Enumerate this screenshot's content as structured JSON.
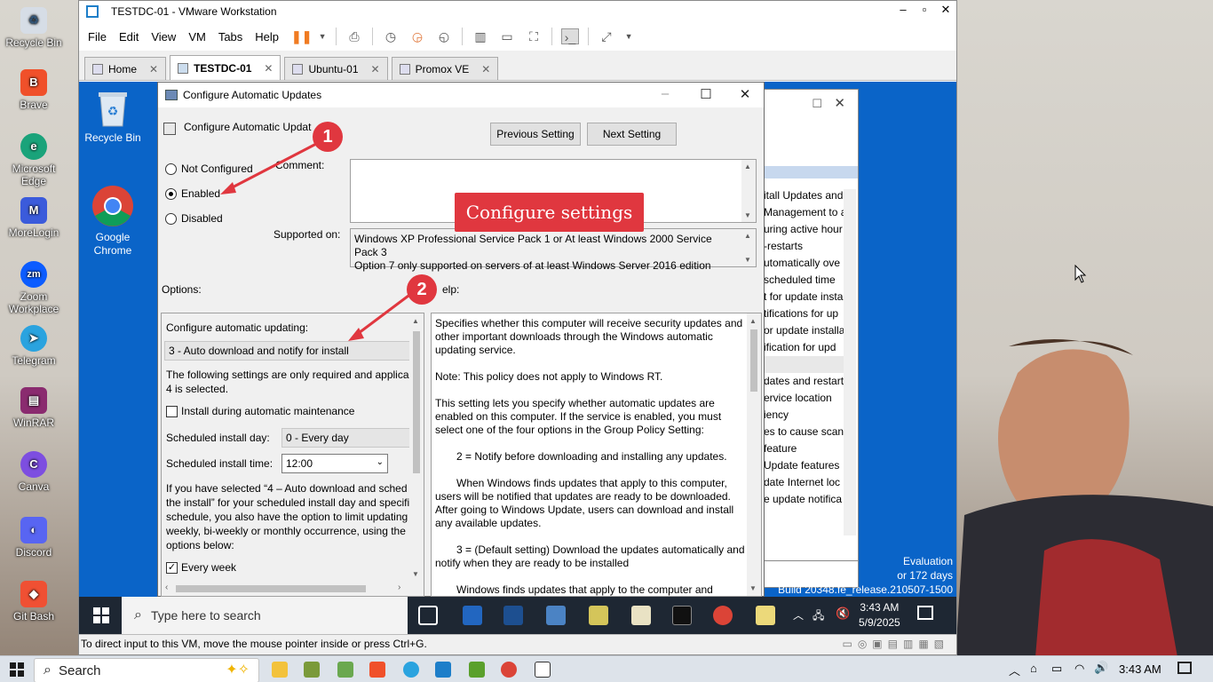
{
  "host_desktop": {
    "icons": [
      {
        "label": "Recycle Bin"
      },
      {
        "label": "Brave"
      },
      {
        "label": "Microsoft Edge"
      },
      {
        "label": "MoreLogin"
      },
      {
        "label": "Zoom Workplace"
      },
      {
        "label": "Telegram"
      },
      {
        "label": "WinRAR"
      },
      {
        "label": "Canva"
      },
      {
        "label": "Discord"
      },
      {
        "label": "Git Bash"
      }
    ]
  },
  "vmware": {
    "title": "TESTDC-01 - VMware Workstation",
    "menu": [
      "File",
      "Edit",
      "View",
      "VM",
      "Tabs",
      "Help"
    ],
    "tabs": [
      {
        "label": "Home"
      },
      {
        "label": "TESTDC-01"
      },
      {
        "label": "Ubuntu-01"
      },
      {
        "label": "Promox VE"
      }
    ],
    "status_text": "To direct input to this VM, move the mouse pointer inside or press Ctrl+G."
  },
  "guest_desktop": {
    "icons": [
      {
        "label": "Recycle Bin"
      },
      {
        "label": "Google Chrome"
      }
    ],
    "watermark": [
      "Evaluation",
      "or 172 days",
      "Build 20348.fe_release.210507-1500"
    ]
  },
  "background_window": {
    "items": [
      "itall Updates and",
      "Management to a",
      "uring active hour",
      "-restarts",
      "utomatically ove",
      "scheduled time",
      "t for update insta",
      "tifications for up",
      "or update installa",
      "ification for upd",
      "dates and restart",
      "ervice location",
      "iency",
      "es to cause scans",
      "feature",
      "Update features",
      "date Internet loc",
      "e update notifica"
    ]
  },
  "dialog": {
    "title": "Configure Automatic Updates",
    "heading": "Configure Automatic Updat",
    "prev_button": "Previous Setting",
    "next_button": "Next Setting",
    "radios": [
      {
        "label": "Not Configured",
        "checked": false
      },
      {
        "label": "Enabled",
        "checked": true
      },
      {
        "label": "Disabled",
        "checked": false
      }
    ],
    "comment_label": "Comment:",
    "supported_label": "Supported on:",
    "supported_text": "Windows XP Professional Service Pack 1 or At least Windows 2000 Service Pack 3\nOption 7 only supported on servers of at least Windows Server 2016 edition",
    "options_label": "Options:",
    "help_label": "elp:",
    "options": {
      "configure_label": "Configure automatic updating:",
      "configure_value": "3 - Auto download and notify for install",
      "note": "The following settings are only required and applical 4 is selected.",
      "maintenance_label": "Install during automatic maintenance",
      "maintenance_checked": false,
      "install_day_label": "Scheduled install day:",
      "install_day_value": "0 - Every day",
      "install_time_label": "Scheduled install time:",
      "install_time_value": "12:00",
      "limit_text": "If you have selected “4 – Auto download and sched the install” for your scheduled install day and specifi schedule, you also have the option to limit updating weekly, bi-weekly or monthly occurrence, using the options below:",
      "every_week_label": "Every week",
      "every_week_checked": true
    },
    "help_paragraphs": [
      "Specifies whether this computer will receive security updates and other important downloads through the Windows automatic updating service.",
      "Note: This policy does not apply to Windows RT.",
      "This setting lets you specify whether automatic updates are enabled on this computer. If the service is enabled, you must select one of the four options in the Group Policy Setting:",
      "2 = Notify before downloading and installing any updates.",
      "When Windows finds updates that apply to this computer, users will be notified that updates are ready to be downloaded. After going to Windows Update, users can download and install any available updates.",
      "3 = (Default setting) Download the updates automatically and notify when they are ready to be installed",
      "Windows finds updates that apply to the computer and"
    ]
  },
  "annotations": {
    "callout_1": "1",
    "callout_2": "2",
    "banner": "Configure settings"
  },
  "guest_taskbar": {
    "search_placeholder": "Type here to search",
    "time": "3:43 AM",
    "date": "5/9/2025"
  },
  "host_taskbar": {
    "search_label": "Search",
    "time": "3:43 AM"
  }
}
